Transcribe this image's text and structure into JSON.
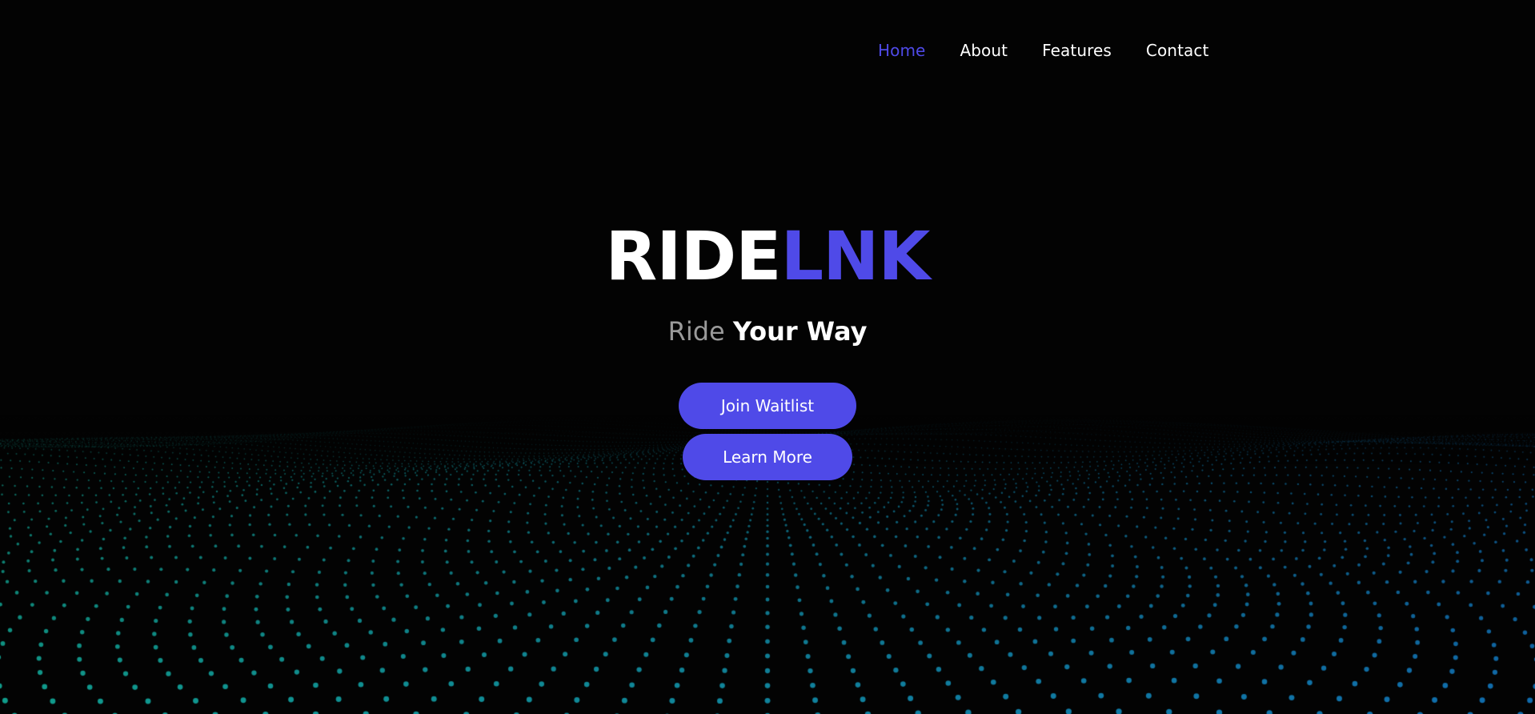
{
  "colors": {
    "accent": "#4f4ae8",
    "background": "#030303",
    "wave_dots": "#1e8ea8"
  },
  "nav": {
    "items": [
      {
        "label": "Home",
        "active": true
      },
      {
        "label": "About",
        "active": false
      },
      {
        "label": "Features",
        "active": false
      },
      {
        "label": "Contact",
        "active": false
      }
    ]
  },
  "hero": {
    "logo_part1": "RIDE",
    "logo_part2": "LNK",
    "tagline_muted": "Ride",
    "tagline_strong": "Your Way",
    "primary_button": "Join Waitlist",
    "secondary_button": "Learn More"
  }
}
